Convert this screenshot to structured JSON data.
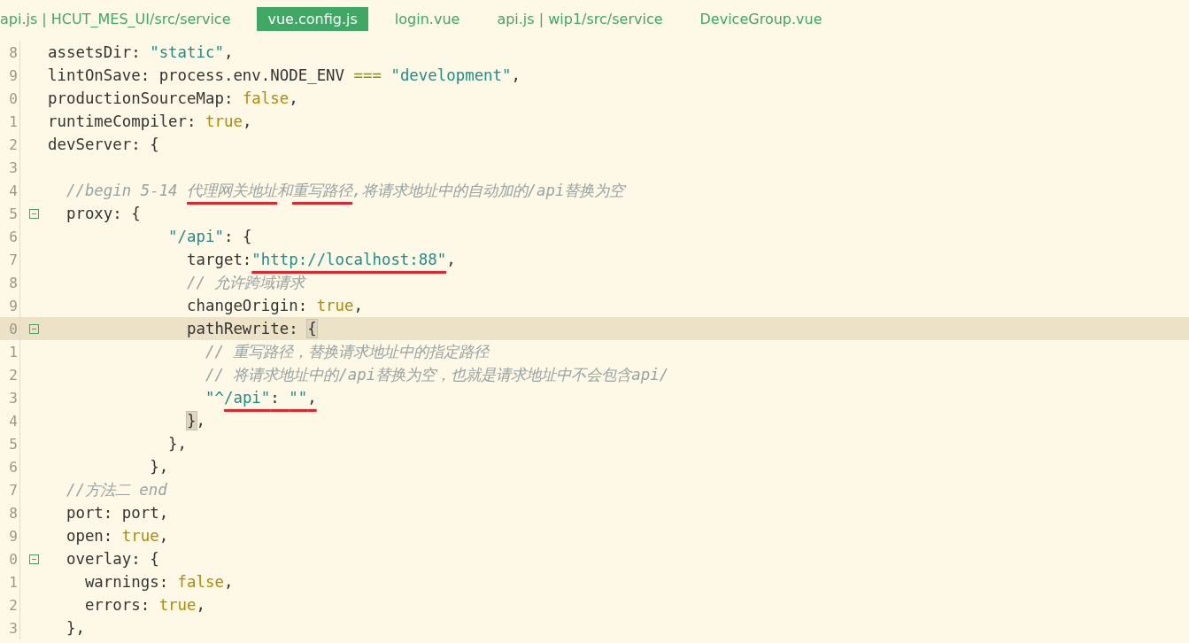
{
  "tabs": [
    {
      "label": "api.js | HCUT_MES_UI/src/service",
      "selected": false
    },
    {
      "label": "vue.config.js",
      "selected": true
    },
    {
      "label": "login.vue",
      "selected": false
    },
    {
      "label": "api.js | wip1/src/service",
      "selected": false
    },
    {
      "label": "DeviceGroup.vue",
      "selected": false
    }
  ],
  "editor": {
    "lines": [
      {
        "number": "8",
        "fold": false,
        "current": false,
        "tokens": [
          {
            "text": "assetsDir: ",
            "kind": "plain"
          },
          {
            "text": "\"static\"",
            "kind": "string"
          },
          {
            "text": ",",
            "kind": "plain"
          }
        ]
      },
      {
        "number": "9",
        "fold": false,
        "current": false,
        "tokens": [
          {
            "text": "lintOnSave: process.env.NODE_ENV ",
            "kind": "plain"
          },
          {
            "text": "=== ",
            "kind": "operator"
          },
          {
            "text": "\"development\"",
            "kind": "string"
          },
          {
            "text": ",",
            "kind": "plain"
          }
        ]
      },
      {
        "number": "0",
        "fold": false,
        "current": false,
        "tokens": [
          {
            "text": "productionSourceMap: ",
            "kind": "plain"
          },
          {
            "text": "false",
            "kind": "keyword"
          },
          {
            "text": ",",
            "kind": "plain"
          }
        ]
      },
      {
        "number": "1",
        "fold": false,
        "current": false,
        "tokens": [
          {
            "text": "runtimeCompiler: ",
            "kind": "plain"
          },
          {
            "text": "true",
            "kind": "keyword"
          },
          {
            "text": ",",
            "kind": "plain"
          }
        ]
      },
      {
        "number": "2",
        "fold": false,
        "current": false,
        "tokens": [
          {
            "text": "devServer: {",
            "kind": "plain"
          }
        ]
      },
      {
        "number": "3",
        "fold": false,
        "current": false
      },
      {
        "number": "4",
        "fold": false,
        "current": false,
        "tokens": [
          {
            "text": "  //begin 5-14 ",
            "kind": "comment"
          },
          {
            "text": "代理网关地址",
            "kind": "comment",
            "marked": true
          },
          {
            "text": "和",
            "kind": "comment"
          },
          {
            "text": "重写路径",
            "kind": "comment",
            "marked": true
          },
          {
            "text": ",将请求地址中的自动加的/api替换为空",
            "kind": "comment"
          }
        ]
      },
      {
        "number": "5",
        "fold": true,
        "current": false,
        "tokens": [
          {
            "text": "  proxy: {",
            "kind": "plain"
          }
        ]
      },
      {
        "number": "6",
        "fold": false,
        "current": false,
        "tokens": [
          {
            "text": "             \"/api\"",
            "kind": "string"
          },
          {
            "text": ": {",
            "kind": "plain"
          }
        ]
      },
      {
        "number": "7",
        "fold": false,
        "current": false,
        "tokens": [
          {
            "text": "               target:",
            "kind": "plain"
          },
          {
            "text": "\"http://localhost:88\"",
            "kind": "string",
            "marked": true
          },
          {
            "text": ",",
            "kind": "plain"
          }
        ]
      },
      {
        "number": "8",
        "fold": false,
        "current": false,
        "tokens": [
          {
            "text": "               // 允许跨域请求",
            "kind": "comment"
          }
        ]
      },
      {
        "number": "9",
        "fold": false,
        "current": false,
        "tokens": [
          {
            "text": "               changeOrigin: ",
            "kind": "plain"
          },
          {
            "text": "true",
            "kind": "keyword"
          },
          {
            "text": ",",
            "kind": "plain"
          }
        ]
      },
      {
        "number": "0",
        "fold": true,
        "current": true,
        "tokens": [
          {
            "text": "               pathRewrite: ",
            "kind": "plain"
          },
          {
            "text": "{",
            "kind": "plain",
            "matched": true
          }
        ]
      },
      {
        "number": "1",
        "fold": false,
        "current": false,
        "tokens": [
          {
            "text": "                 // 重写路径，替换请求地址中的指定路径",
            "kind": "comment"
          }
        ]
      },
      {
        "number": "2",
        "fold": false,
        "current": false,
        "tokens": [
          {
            "text": "                 // 将请求地址中的/api替换为空，也就是请求地址中不会包含api/",
            "kind": "comment"
          }
        ]
      },
      {
        "number": "3",
        "fold": false,
        "current": false,
        "tokens": [
          {
            "text": "                 \"^",
            "kind": "string"
          },
          {
            "text": "/api\"",
            "kind": "string",
            "marked": true
          },
          {
            "text": ": ",
            "kind": "plain",
            "marked": true
          },
          {
            "text": "\"\"",
            "kind": "string",
            "marked": true
          },
          {
            "text": ",",
            "kind": "plain",
            "marked": true
          }
        ]
      },
      {
        "number": "4",
        "fold": false,
        "current": false,
        "tokens": [
          {
            "text": "               }",
            "kind": "plain",
            "matched": true
          },
          {
            "text": ",",
            "kind": "plain"
          }
        ]
      },
      {
        "number": "5",
        "fold": false,
        "current": false,
        "tokens": [
          {
            "text": "             },",
            "kind": "plain"
          }
        ]
      },
      {
        "number": "6",
        "fold": false,
        "current": false,
        "tokens": [
          {
            "text": "           },",
            "kind": "plain"
          }
        ]
      },
      {
        "number": "7",
        "fold": false,
        "current": false,
        "tokens": [
          {
            "text": "  //方法二 end",
            "kind": "comment"
          }
        ]
      },
      {
        "number": "8",
        "fold": false,
        "current": false,
        "tokens": [
          {
            "text": "  port: port,",
            "kind": "plain"
          }
        ]
      },
      {
        "number": "9",
        "fold": false,
        "current": false,
        "tokens": [
          {
            "text": "  open: ",
            "kind": "plain"
          },
          {
            "text": "true",
            "kind": "keyword"
          },
          {
            "text": ",",
            "kind": "plain"
          }
        ]
      },
      {
        "number": "0",
        "fold": true,
        "current": false,
        "tokens": [
          {
            "text": "  overlay: {",
            "kind": "plain"
          }
        ]
      },
      {
        "number": "1",
        "fold": false,
        "current": false,
        "tokens": [
          {
            "text": "    warnings: ",
            "kind": "plain"
          },
          {
            "text": "false",
            "kind": "keyword"
          },
          {
            "text": ",",
            "kind": "plain"
          }
        ]
      },
      {
        "number": "2",
        "fold": false,
        "current": false,
        "tokens": [
          {
            "text": "    errors: ",
            "kind": "plain"
          },
          {
            "text": "true",
            "kind": "keyword"
          },
          {
            "text": ",",
            "kind": "plain"
          }
        ]
      },
      {
        "number": "3",
        "fold": false,
        "current": false,
        "tokens": [
          {
            "text": "  },",
            "kind": "plain"
          }
        ]
      }
    ]
  }
}
